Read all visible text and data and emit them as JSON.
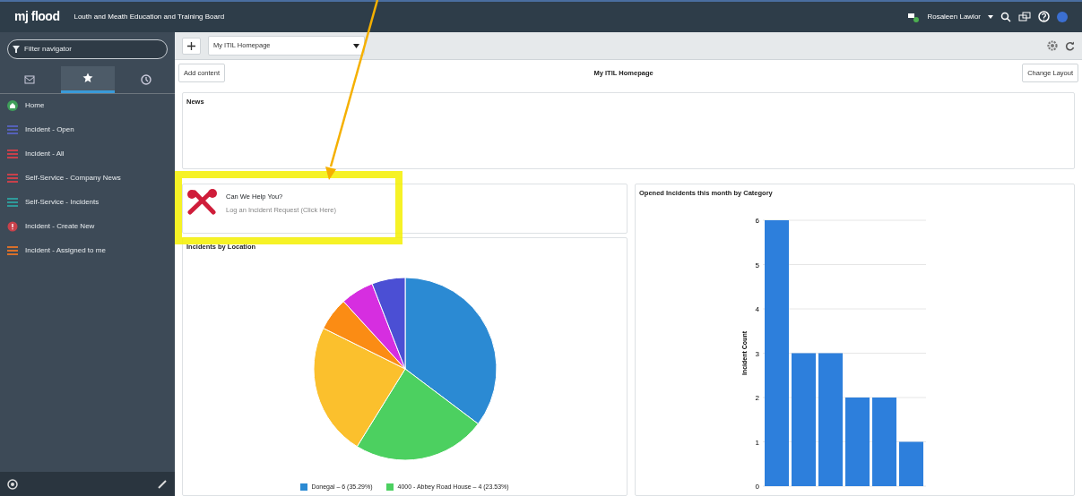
{
  "header": {
    "logo": "mj flood",
    "organization": "Louth and Meath Education and Training Board",
    "user": "Rosaleen Lawlor"
  },
  "navigator": {
    "placeholder": "Filter navigator",
    "tabs": [
      {
        "kind": "inbox",
        "selected": false
      },
      {
        "kind": "star",
        "selected": true
      },
      {
        "kind": "history",
        "selected": false
      }
    ],
    "items": [
      {
        "label": "Home",
        "kind": "home",
        "color": "#3f9e5a"
      },
      {
        "label": "Incident - Open",
        "kind": "list",
        "color": "#5561b8"
      },
      {
        "label": "Incident - All",
        "kind": "list",
        "color": "#c8414b"
      },
      {
        "label": "Self-Service - Company News",
        "kind": "list",
        "color": "#c8414b"
      },
      {
        "label": "Self-Service - Incidents",
        "kind": "list",
        "color": "#2f9a9a"
      },
      {
        "label": "Incident - Create New",
        "kind": "alert",
        "color": "#c8414b"
      },
      {
        "label": "Incident - Assigned to me",
        "kind": "list",
        "color": "#d9702a"
      }
    ]
  },
  "toolbar": {
    "dashboard": "My ITIL Homepage"
  },
  "page": {
    "title": "My ITIL Homepage",
    "add_button": "Add content",
    "layout_button": "Change Layout"
  },
  "news": {
    "title": "News"
  },
  "help": {
    "title": "Can We Help You?",
    "link": "Log an Incident Request (Click Here)"
  },
  "location": {
    "chart_data": {
      "type": "pie",
      "title": "Incidents by Location",
      "values": [
        35.29,
        23.53,
        23.53,
        5.88,
        5.88,
        5.89
      ],
      "colors": [
        "#2b8ad3",
        "#4cd060",
        "#fbc02d",
        "#fb8c14",
        "#d62ee0",
        "#4b4fd4"
      ]
    },
    "legend": [
      {
        "text": "Donegal – 6 (35.29%)",
        "color": "#2b8ad3"
      },
      {
        "text": "4000 - Abbey Road House – 4 (23.53%)",
        "color": "#4cd060"
      }
    ]
  },
  "category": {
    "chart_data": {
      "type": "bar",
      "title": "Opened Incidents this month by Category",
      "ylabel": "Incident Count",
      "values": [
        6,
        3,
        3,
        2,
        2,
        1
      ],
      "ylim": [
        0,
        6
      ],
      "yticks": [
        0,
        1,
        2,
        3,
        4,
        5,
        6
      ],
      "grid": true
    }
  },
  "annotations": [
    {
      "kind": "highlight"
    },
    {
      "kind": "arrow"
    }
  ]
}
